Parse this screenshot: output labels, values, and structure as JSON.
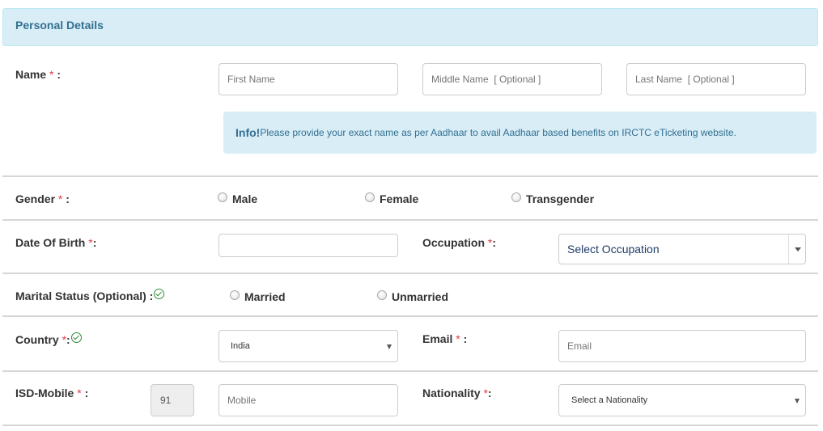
{
  "panel": {
    "title": "Personal Details"
  },
  "name": {
    "label": "Name",
    "suffix": " :",
    "first_placeholder": "First Name",
    "middle_placeholder": "Middle Name  [ Optional ]",
    "last_placeholder": "Last Name  [ Optional ]"
  },
  "info": {
    "strong": "Info!",
    "text": "Please provide your exact name as per Aadhaar to avail Aadhaar based benefits on IRCTC eTicketing website."
  },
  "gender": {
    "label": "Gender",
    "suffix": " :",
    "options": [
      "Male",
      "Female",
      "Transgender"
    ]
  },
  "dob": {
    "label": "Date Of Birth ",
    "suffix": ":",
    "value": ""
  },
  "occupation": {
    "label": "Occupation ",
    "suffix": ":",
    "selected": "Select Occupation"
  },
  "marital": {
    "label": "Marital Status (Optional) :",
    "options": [
      "Married",
      "Unmarried"
    ]
  },
  "country": {
    "label": "Country ",
    "suffix": ":",
    "selected": "India"
  },
  "email": {
    "label": "Email",
    "suffix": " :",
    "placeholder": "Email"
  },
  "mobile": {
    "label": "ISD-Mobile",
    "suffix": " :",
    "isd": "91",
    "placeholder": "Mobile"
  },
  "nationality": {
    "label": "Nationality ",
    "suffix": ":",
    "selected": "Select a Nationality"
  },
  "required_mark": "*",
  "colors": {
    "info_bg": "#d9edf7",
    "info_text": "#31708f",
    "required": "#e4393c",
    "check": "#2e8b3a"
  }
}
